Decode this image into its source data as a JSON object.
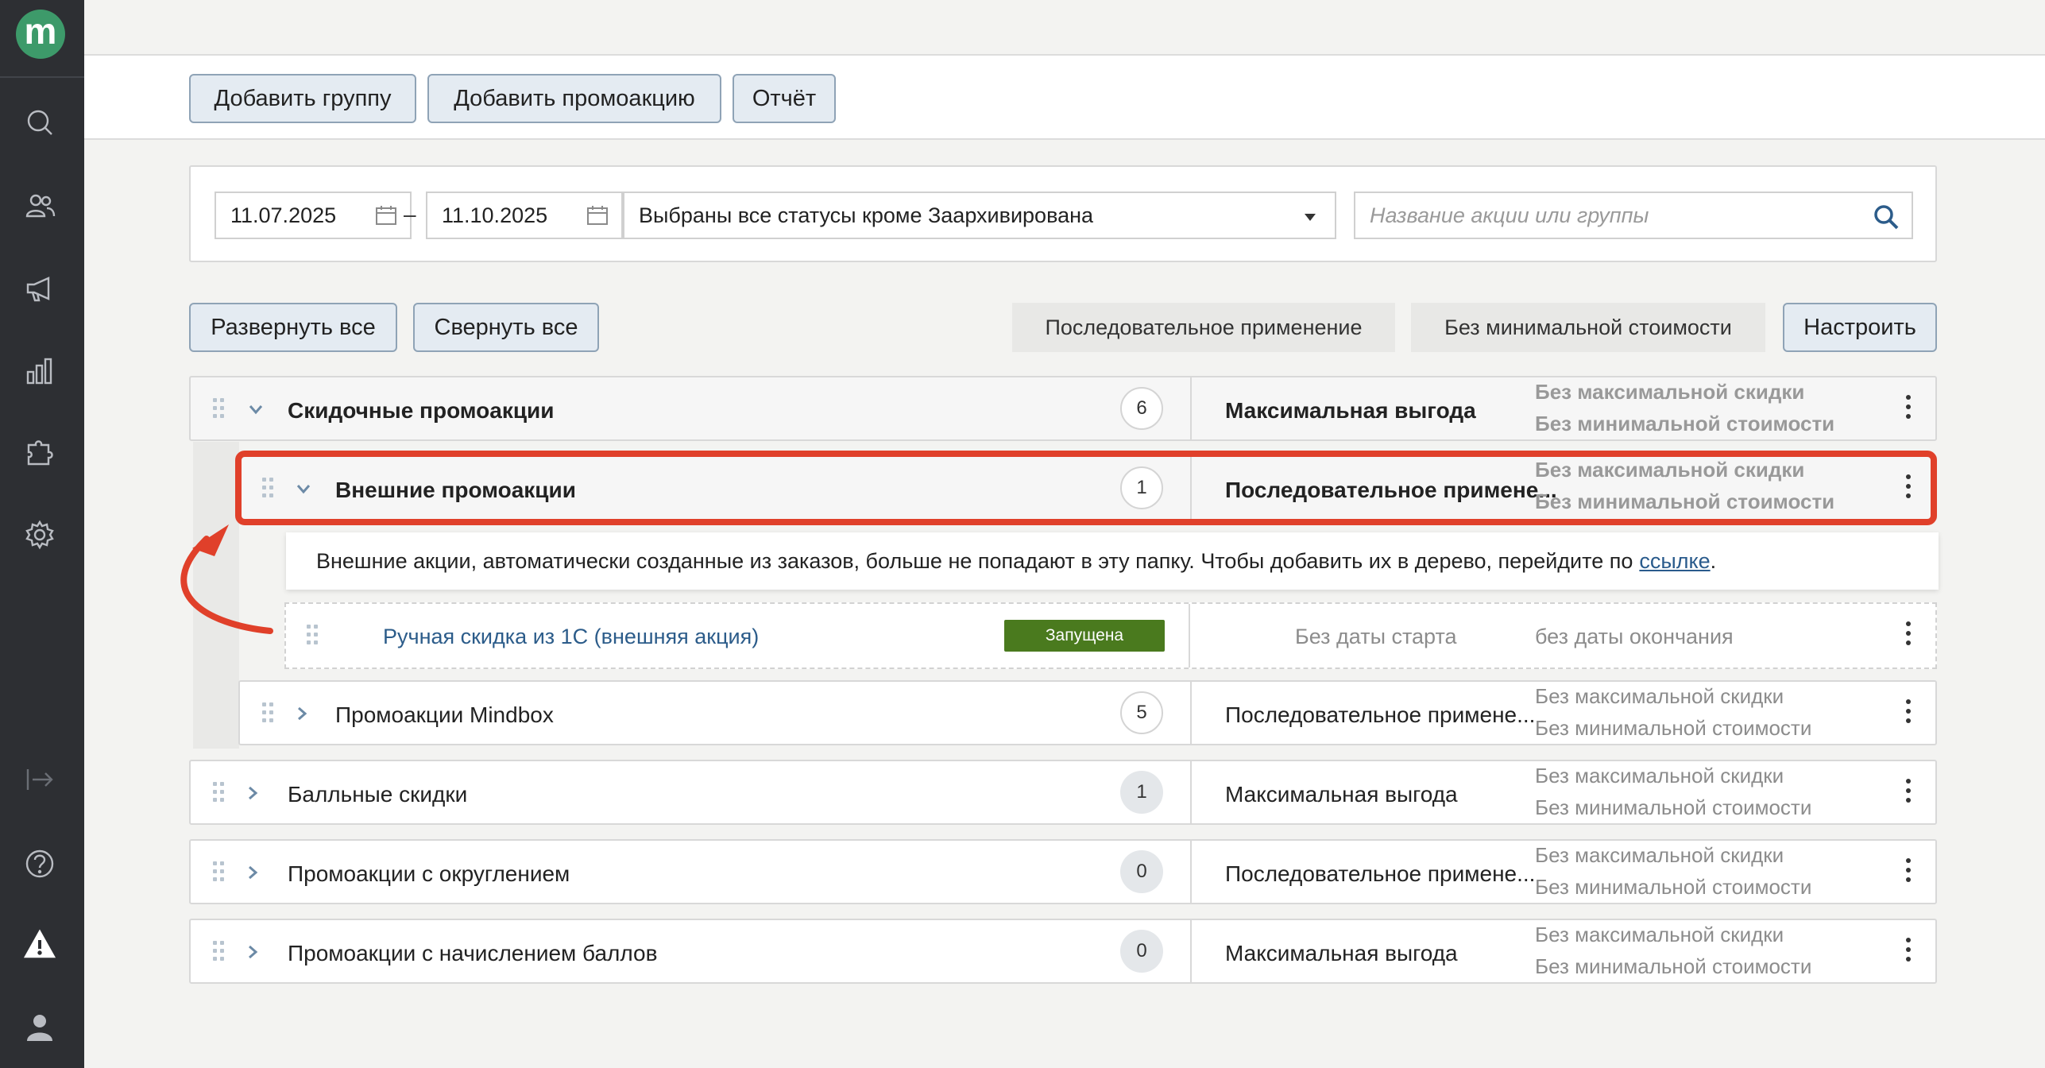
{
  "app": {
    "logo_letter": "m",
    "sidebar_icons": [
      "search-icon",
      "users-icon",
      "megaphone-icon",
      "bar-chart-icon",
      "puzzle-icon",
      "gear-icon",
      "logout-icon",
      "help-icon",
      "warning-icon",
      "profile-icon"
    ]
  },
  "toolbar": {
    "add_group": "Добавить группу",
    "add_promo": "Добавить промоакцию",
    "report": "Отчёт"
  },
  "filter": {
    "date_from": "11.07.2025",
    "date_separator": "–",
    "date_to": "11.10.2025",
    "status": "Выбраны все статусы кроме Заархивирована",
    "search_placeholder": "Название акции или группы"
  },
  "controls": {
    "expand_all": "Развернуть все",
    "collapse_all": "Свернуть все",
    "chip_application": "Последовательное применение",
    "chip_min_cost": "Без минимальной стоимости",
    "configure": "Настроить"
  },
  "groups": [
    {
      "name": "Скидочные промоакции",
      "count": "6",
      "mode": "Максимальная выгода",
      "limit_discount": "Без максимальной скидки",
      "limit_cost": "Без минимальной стоимости"
    },
    {
      "name": "Внешние промоакции",
      "count": "1",
      "mode": "Последовательное примене...",
      "limit_discount": "Без максимальной скидки",
      "limit_cost": "Без минимальной стоимости"
    },
    {
      "name": "Промоакции Mindbox",
      "count": "5",
      "mode": "Последовательное примене...",
      "limit_discount": "Без максимальной скидки",
      "limit_cost": "Без минимальной стоимости"
    },
    {
      "name": "Балльные скидки",
      "count": "1",
      "mode": "Максимальная выгода",
      "limit_discount": "Без максимальной скидки",
      "limit_cost": "Без минимальной стоимости"
    },
    {
      "name": "Промоакции с округлением",
      "count": "0",
      "mode": "Последовательное примене...",
      "limit_discount": "Без максимальной скидки",
      "limit_cost": "Без минимальной стоимости"
    },
    {
      "name": "Промоакции с начислением баллов",
      "count": "0",
      "mode": "Максимальная выгода",
      "limit_discount": "Без максимальной скидки",
      "limit_cost": "Без минимальной стоимости"
    }
  ],
  "info": {
    "text": "Внешние акции, автоматически созданные из заказов, больше не попадают в эту папку. Чтобы добавить их в дерево, перейдите по",
    "link": "ссылке",
    "suffix": "."
  },
  "promo": {
    "name": "Ручная скидка из 1С (внешняя акция)",
    "status": "Запущена",
    "start": "Без даты старта",
    "end": "без даты окончания"
  },
  "colors": {
    "sidebar": "#2d2f33",
    "accent_logo": "#3d9a6a",
    "highlight": "#e0402a",
    "status_running": "#4a7a1e",
    "link": "#2c5c8a"
  }
}
